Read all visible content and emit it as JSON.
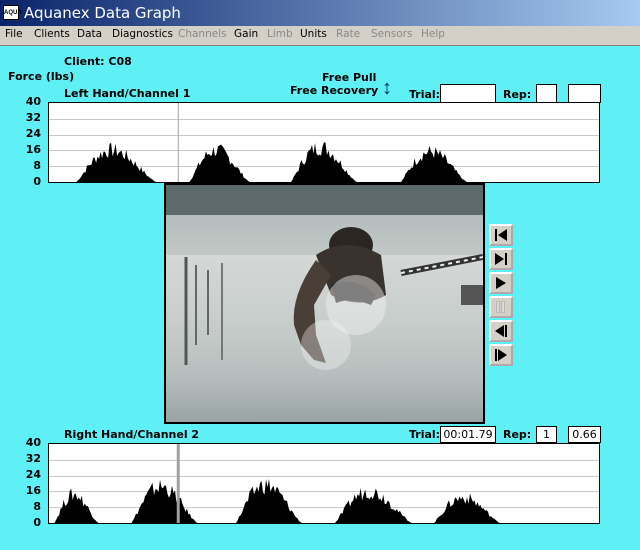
{
  "window": {
    "title": "Aquanex Data Graph",
    "icon_label": "AQUA"
  },
  "menu": [
    {
      "label": "File",
      "enabled": true
    },
    {
      "label": "Clients",
      "enabled": true
    },
    {
      "label": "Data",
      "enabled": true
    },
    {
      "label": "Diagnostics",
      "enabled": true
    },
    {
      "label": "Channels",
      "enabled": false
    },
    {
      "label": "Gain",
      "enabled": true
    },
    {
      "label": "Limb",
      "enabled": false
    },
    {
      "label": "Units",
      "enabled": true
    },
    {
      "label": "Rate",
      "enabled": false
    },
    {
      "label": "Sensors",
      "enabled": false
    },
    {
      "label": "Help",
      "enabled": false
    }
  ],
  "client": "Client: C08",
  "force_label": "Force (lbs)",
  "mode": {
    "line1": "Free Pull",
    "line2": "Free Recovery"
  },
  "top": {
    "channel_label": "Left Hand/Channel 1",
    "trial_label": "Trial:",
    "trial_value": "",
    "rep_label": "Rep:",
    "rep_value": "",
    "extra_value": ""
  },
  "bottom": {
    "channel_label": "Right Hand/Channel 2",
    "trial_label": "Trial:",
    "trial_value": "00:01.79",
    "rep_label": "Rep:",
    "rep_value": "1",
    "extra_value": "0.66"
  },
  "y_ticks": [
    "40",
    "32",
    "24",
    "16",
    "8",
    "0"
  ],
  "colors": {
    "background": "#5ff0f6",
    "waveform": "#000000",
    "cursor": "#a0a0a0"
  },
  "video_controls": [
    "skip-start-icon",
    "play-slow-icon",
    "play-icon",
    "pause-icon",
    "step-back-icon",
    "step-forward-icon"
  ],
  "chart_data": [
    {
      "type": "area",
      "name": "Left Hand/Channel 1",
      "ylim": [
        0,
        40
      ],
      "ylabel": "Force (lbs)",
      "cursor_x": 0.235,
      "peaks": [
        {
          "start": 0.05,
          "end": 0.195,
          "max": 20
        },
        {
          "start": 0.255,
          "end": 0.365,
          "max": 20
        },
        {
          "start": 0.44,
          "end": 0.56,
          "max": 22
        },
        {
          "start": 0.64,
          "end": 0.76,
          "max": 19
        }
      ]
    },
    {
      "type": "area",
      "name": "Right Hand/Channel 2",
      "ylim": [
        0,
        40
      ],
      "ylabel": "Force (lbs)",
      "cursor_x": 0.235,
      "peaks": [
        {
          "start": 0.01,
          "end": 0.09,
          "max": 18
        },
        {
          "start": 0.15,
          "end": 0.27,
          "max": 23
        },
        {
          "start": 0.34,
          "end": 0.46,
          "max": 24
        },
        {
          "start": 0.52,
          "end": 0.66,
          "max": 20
        },
        {
          "start": 0.7,
          "end": 0.82,
          "max": 16
        }
      ]
    }
  ]
}
